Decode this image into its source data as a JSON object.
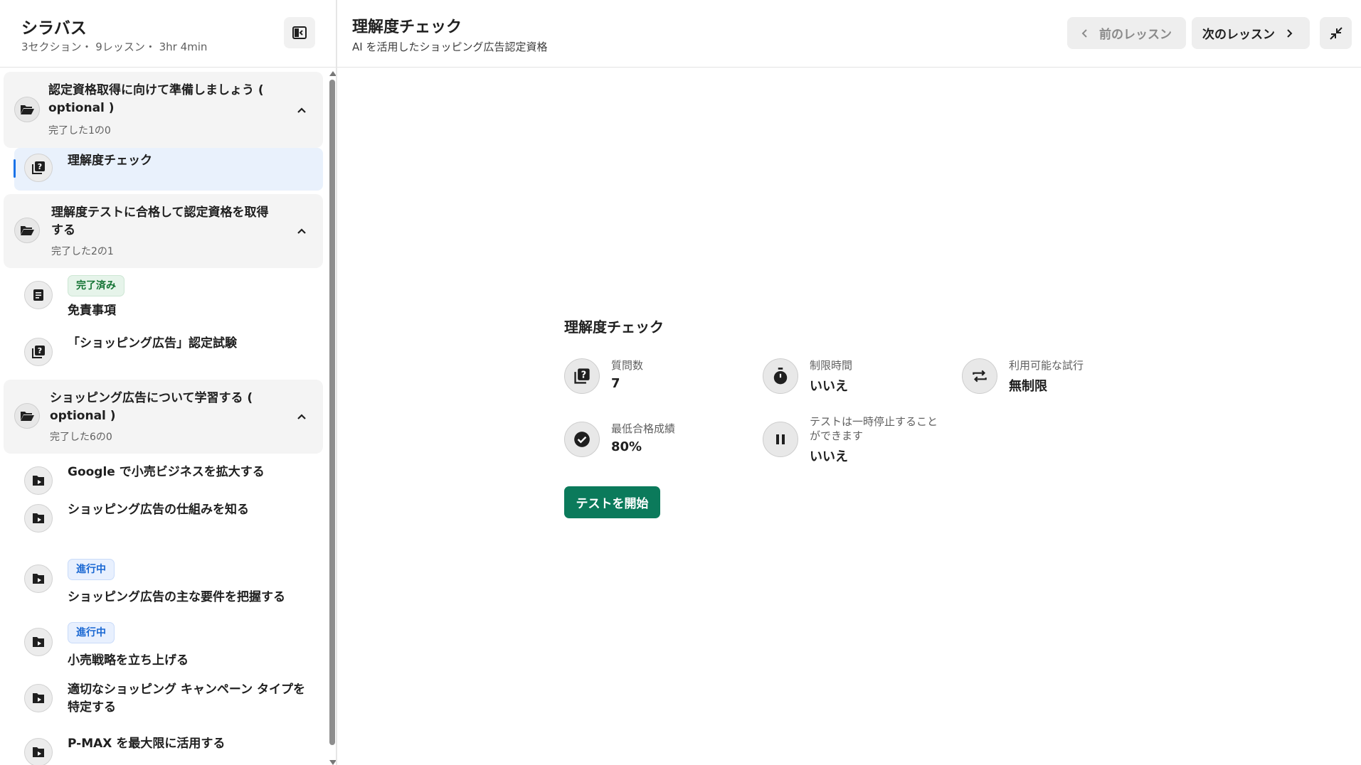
{
  "sidebar": {
    "title": "シラバス",
    "meta": "3セクション・ 9レッスン・ 3hr 4min",
    "sections": [
      {
        "title": "認定資格取得に向けて準備しましょう ( optional )",
        "count": "完了した1の0",
        "lessons": [
          {
            "title": "理解度チェック",
            "icon": "quiz-icon",
            "active": true
          }
        ]
      },
      {
        "title": "理解度テストに合格して認定資格を取得する",
        "count": "完了した2の1",
        "lessons": [
          {
            "title": "免責事項",
            "icon": "document-icon",
            "badge": "完了済み"
          },
          {
            "title": "「ショッピング広告」認定試験",
            "icon": "quiz-icon"
          }
        ]
      },
      {
        "title": "ショッピング広告について学習する ( optional )",
        "count": "完了した6の0",
        "lessons": [
          {
            "title": "Google で小売ビジネスを拡大する",
            "icon": "video-folder-icon"
          },
          {
            "title": "ショッピング広告の仕組みを知る",
            "icon": "video-folder-icon"
          },
          {
            "title": "ショッピング広告の主な要件を把握する",
            "icon": "video-folder-icon",
            "badge": "進行中"
          },
          {
            "title": "小売戦略を立ち上げる",
            "icon": "video-folder-icon",
            "badge": "進行中"
          },
          {
            "title": "適切なショッピング キャンペーン タイプを特定する",
            "icon": "video-folder-icon"
          },
          {
            "title": "P-MAX を最大限に活用する",
            "icon": "video-folder-icon"
          }
        ]
      }
    ]
  },
  "header": {
    "title": "理解度チェック",
    "subtitle": "AI を活用したショッピング広告認定資格",
    "prev_label": "前のレッスン",
    "next_label": "次のレッスン"
  },
  "quiz": {
    "title": "理解度チェック",
    "stats": [
      {
        "label": "質問数",
        "value": "7",
        "icon": "question-icon"
      },
      {
        "label": "制限時間",
        "value": "いいえ",
        "icon": "timer-icon"
      },
      {
        "label": "利用可能な試行",
        "value": "無制限",
        "icon": "repeat-icon"
      },
      {
        "label": "最低合格成績",
        "value": "80%",
        "icon": "check-circle-icon"
      },
      {
        "label": "テストは一時停止することができます",
        "value": "いいえ",
        "icon": "pause-icon"
      }
    ],
    "start_label": "テストを開始"
  },
  "colors": {
    "accent_green": "#0b7a5b",
    "active_bg": "#e9f1fc",
    "active_bar": "#1a73e8",
    "done_badge": "#137333",
    "progress_badge": "#1967d2"
  }
}
